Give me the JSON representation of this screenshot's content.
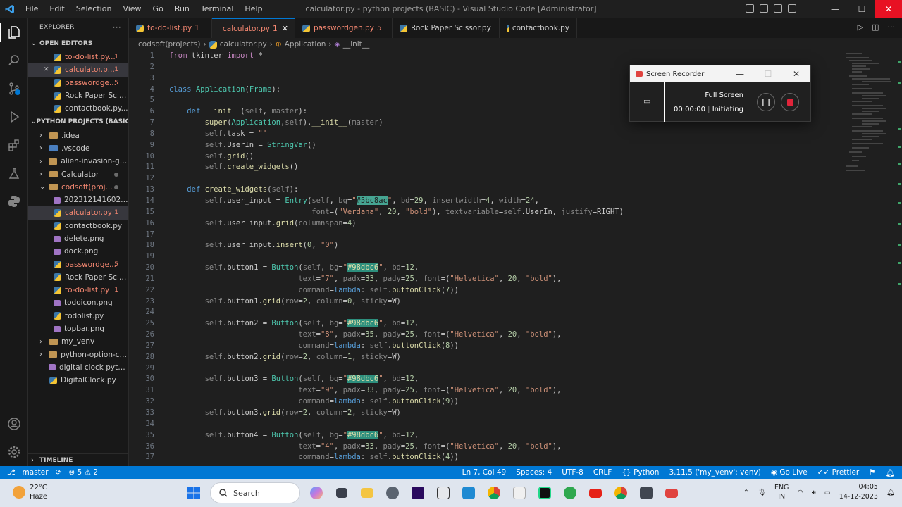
{
  "window": {
    "title": "calculator.py - python projects (BASIC) - Visual Studio Code [Administrator]",
    "menu": [
      "File",
      "Edit",
      "Selection",
      "View",
      "Go",
      "Run",
      "Terminal",
      "Help"
    ]
  },
  "sidebar": {
    "header": "EXPLORER",
    "open_editors_title": "OPEN EDITORS",
    "open_editors": [
      {
        "label": "to-do-list.py...",
        "badge": "1",
        "color": "red"
      },
      {
        "label": "calculator.p...",
        "badge": "1",
        "color": "red",
        "close": "✕"
      },
      {
        "label": "passwordge...",
        "badge": "5",
        "color": "red"
      },
      {
        "label": "Rock Paper Sciss...",
        "badge": "",
        "color": "normal"
      },
      {
        "label": "contactbook.py...",
        "badge": "",
        "color": "normal"
      }
    ],
    "project_title": "PYTHON PROJECTS (BASIC)",
    "tree": [
      {
        "label": ".idea",
        "type": "folder",
        "depth": 1
      },
      {
        "label": ".vscode",
        "type": "vscode-folder",
        "depth": 1
      },
      {
        "label": "alien-invasion-ga...",
        "type": "folder",
        "depth": 1
      },
      {
        "label": "Calculator",
        "type": "folder",
        "depth": 1,
        "dot": true
      },
      {
        "label": "codsoft(proj...",
        "type": "folder-open",
        "depth": 1,
        "color": "red",
        "dot": true
      },
      {
        "label": "2023121416020...",
        "type": "img",
        "depth": 2
      },
      {
        "label": "calculator.py",
        "type": "py",
        "depth": 2,
        "color": "red",
        "badge": "1",
        "selected": true
      },
      {
        "label": "contactbook.py",
        "type": "py",
        "depth": 2
      },
      {
        "label": "delete.png",
        "type": "img",
        "depth": 2
      },
      {
        "label": "dock.png",
        "type": "img",
        "depth": 2
      },
      {
        "label": "passwordge...",
        "type": "py",
        "depth": 2,
        "color": "red",
        "badge": "5"
      },
      {
        "label": "Rock Paper Sciss...",
        "type": "py",
        "depth": 2
      },
      {
        "label": "to-do-list.py",
        "type": "py",
        "depth": 2,
        "color": "red",
        "badge": "1"
      },
      {
        "label": "todoicon.png",
        "type": "img",
        "depth": 2
      },
      {
        "label": "todolist.py",
        "type": "py",
        "depth": 2
      },
      {
        "label": "topbar.png",
        "type": "img",
        "depth": 2
      },
      {
        "label": "my_venv",
        "type": "folder",
        "depth": 1
      },
      {
        "label": "python-option-cal...",
        "type": "folder",
        "depth": 1
      },
      {
        "label": "digital clock pytho...",
        "type": "file",
        "depth": 1
      },
      {
        "label": "DigitalClock.py",
        "type": "py",
        "depth": 1
      }
    ],
    "timeline": "TIMELINE"
  },
  "tabs": [
    {
      "label": "to-do-list.py",
      "badge": "1",
      "active": false
    },
    {
      "label": "calculator.py",
      "badge": "1",
      "active": true
    },
    {
      "label": "passwordgen.py",
      "badge": "5",
      "active": false
    },
    {
      "label": "Rock Paper Scissor.py",
      "badge": "",
      "active": false
    },
    {
      "label": "contactbook.py",
      "badge": "",
      "active": false
    }
  ],
  "breadcrumb": [
    "codsoft(projects)",
    "calculator.py",
    "Application",
    "__init__"
  ],
  "recorder": {
    "title": "Screen Recorder",
    "mode": "Full Screen",
    "time": "00:00:00",
    "status": "Initiating"
  },
  "statusbar": {
    "branch": "master",
    "problems": "⊗ 5 ⚠ 2",
    "position": "Ln 7, Col 49",
    "spaces": "Spaces: 4",
    "encoding": "UTF-8",
    "eol": "CRLF",
    "language": "Python",
    "interpreter": "3.11.5 ('my_venv': venv)",
    "golive": "Go Live",
    "prettier": "Prettier"
  },
  "taskbar": {
    "temp": "22°C",
    "weather": "Haze",
    "search": "Search",
    "lang1": "ENG",
    "lang2": "IN",
    "time": "04:05",
    "date": "14-12-2023"
  },
  "colors": {
    "accent": "#0078d4",
    "editor_bg": "#1f1f1f",
    "error": "#f48771",
    "highlight": "#2d8f7d"
  }
}
